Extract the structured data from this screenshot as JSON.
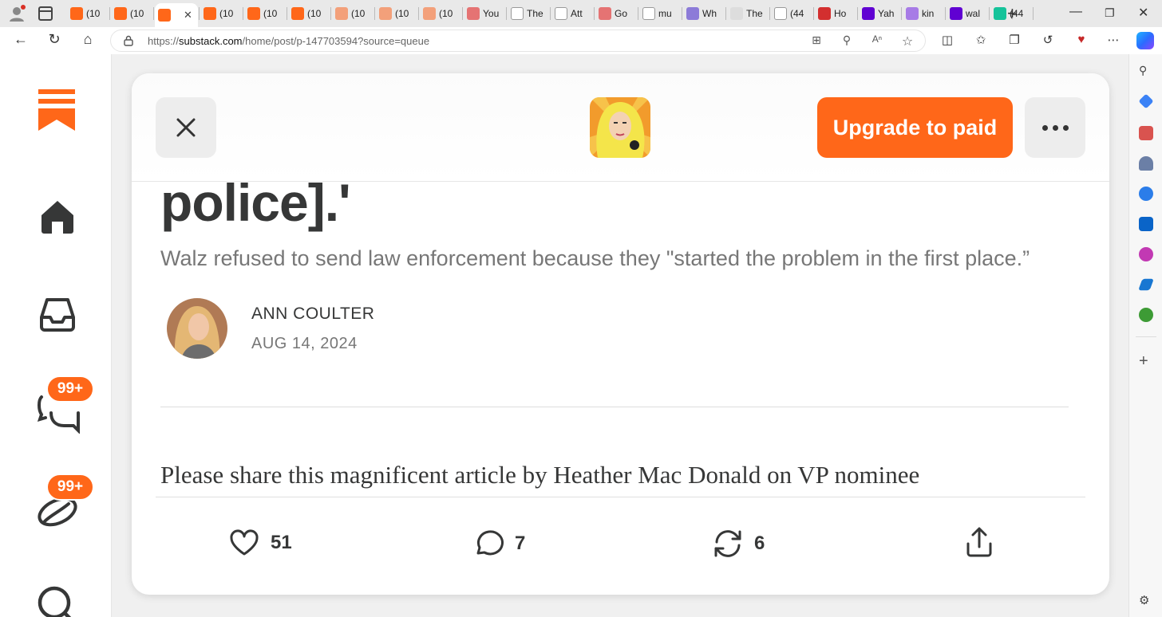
{
  "browser": {
    "tabs": [
      {
        "label": "(10",
        "favicon": "substack-icon",
        "color": "#ff6719"
      },
      {
        "label": "(10",
        "favicon": "substack-icon",
        "color": "#ff6719"
      },
      {
        "label": "",
        "favicon": "substack-icon",
        "color": "#ff6719",
        "active": true
      },
      {
        "label": "(10",
        "favicon": "substack-icon",
        "color": "#ff6719"
      },
      {
        "label": "(10",
        "favicon": "substack-icon",
        "color": "#ff6719"
      },
      {
        "label": "(10",
        "favicon": "substack-icon",
        "color": "#ff6719"
      },
      {
        "label": "(10",
        "favicon": "substack-icon",
        "color": "#f3a07a"
      },
      {
        "label": "(10",
        "favicon": "substack-icon",
        "color": "#f3a07a"
      },
      {
        "label": "(10",
        "favicon": "substack-icon",
        "color": "#f3a07a"
      },
      {
        "label": "You",
        "favicon": "youtube-icon",
        "color": "#e57373"
      },
      {
        "label": "The",
        "favicon": "page-icon",
        "color": "#ffffff"
      },
      {
        "label": "Att",
        "favicon": "page-icon",
        "color": "#ffffff"
      },
      {
        "label": "Go",
        "favicon": "youtube-icon",
        "color": "#e57373"
      },
      {
        "label": "mu",
        "favicon": "page-icon",
        "color": "#ffffff"
      },
      {
        "label": "Wh",
        "favicon": "shield-icon",
        "color": "#8c7bd8"
      },
      {
        "label": "The",
        "favicon": "dots-icon",
        "color": "#dddddd"
      },
      {
        "label": "(44",
        "favicon": "page-icon",
        "color": "#ffffff"
      },
      {
        "label": "Ho",
        "favicon": "mic-icon",
        "color": "#d32f2f"
      },
      {
        "label": "Yah",
        "favicon": "yahoo-icon",
        "color": "#6001d2"
      },
      {
        "label": "kin",
        "favicon": "yahoo-icon",
        "color": "#a77be6"
      },
      {
        "label": "wal",
        "favicon": "yahoo-icon",
        "color": "#6001d2"
      },
      {
        "label": "(44",
        "favicon": "grammarly-icon",
        "color": "#15c39a"
      }
    ],
    "url_prefix": "https://",
    "url_host": "substack.com",
    "url_path": "/home/post/p-147703594?source=queue"
  },
  "header": {
    "upgrade_label": "Upgrade to paid"
  },
  "badges": {
    "chat": "99+",
    "activity": "99+"
  },
  "post": {
    "title_fragment": "police].'",
    "subtitle": "Walz refused to send law enforcement because they \"started the problem in the first place.”",
    "author": "ANN COULTER",
    "date": "AUG 14, 2024",
    "body_first_line": "Please share this magnificent article by Heather Mac Donald on VP nominee"
  },
  "actions": {
    "likes": "51",
    "comments": "7",
    "restacks": "6"
  },
  "colors": {
    "brand": "#ff6719"
  }
}
